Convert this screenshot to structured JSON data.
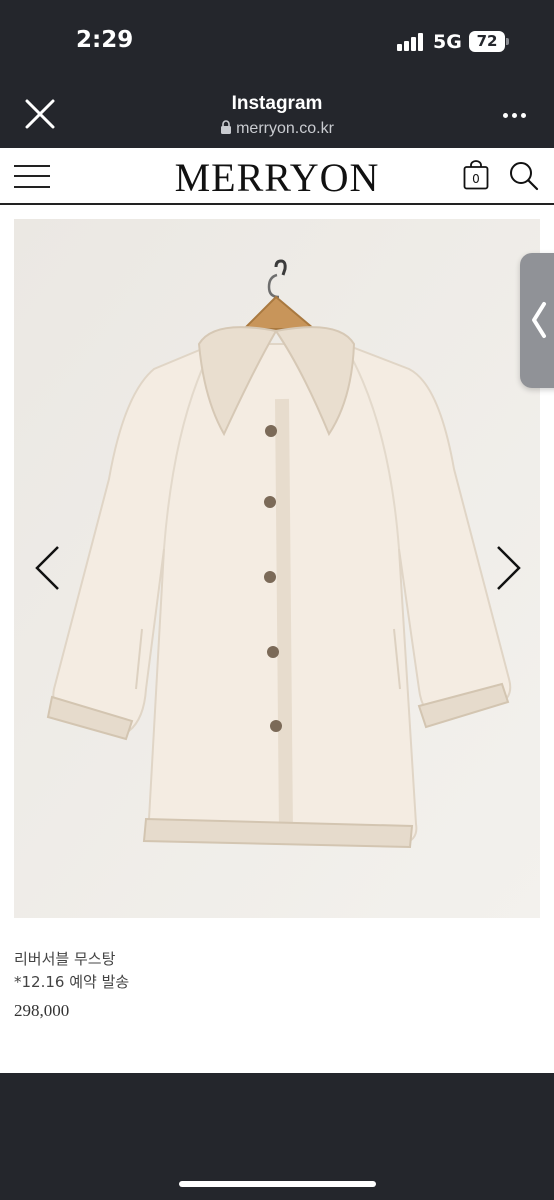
{
  "status_bar": {
    "time": "2:29",
    "network": "5G",
    "battery": "72"
  },
  "browser": {
    "title": "Instagram",
    "url": "merryon.co.kr",
    "close_icon": "close-icon",
    "more_icon": "more-horizontal-icon"
  },
  "site": {
    "logo": "MERRYON",
    "cart_count": "0",
    "menu_icon": "hamburger-icon",
    "cart_icon": "shopping-bag-icon",
    "search_icon": "search-icon"
  },
  "product": {
    "name": "리버서블 무스탕",
    "note": "*12.16 예약 발송",
    "price": "298,000",
    "image": "cream reversible shearling coat on hanger"
  },
  "colors": {
    "chrome": "#24262c",
    "page_bg": "#ffffff",
    "image_bg": "#eeebe6",
    "coat": "#f3ebe1",
    "shearling": "#e6dccd"
  }
}
